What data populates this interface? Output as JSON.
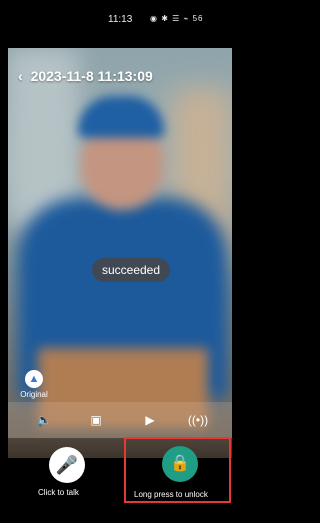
{
  "status_bar": {
    "time": "11:13",
    "icons": "◉ ✱ ☰ ⌁ 56"
  },
  "header": {
    "back_icon": "‹",
    "timestamp": "2023-11-8  11:13:09"
  },
  "toast": {
    "text": "succeeded"
  },
  "original": {
    "badge": "▲",
    "label": "Original"
  },
  "toolbar": {
    "speaker_icon": "🔈",
    "gallery_icon": "▣",
    "camera_icon": "▶",
    "signal_icon": "((•))"
  },
  "actions": {
    "talk_icon": "🎤",
    "talk_label": "Click to talk",
    "unlock_icon": "🔒",
    "unlock_label": "Long press to unlock"
  }
}
